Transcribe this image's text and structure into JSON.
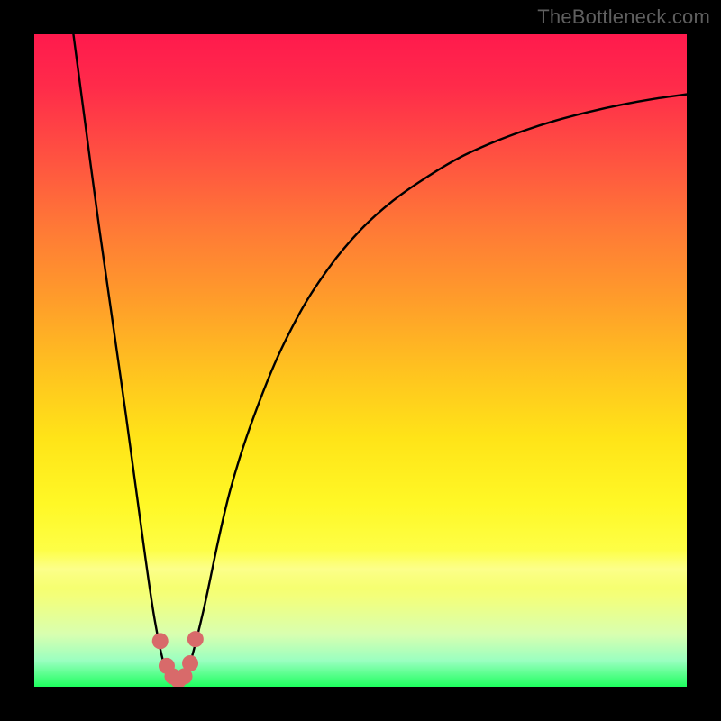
{
  "watermark": "TheBottleneck.com",
  "colors": {
    "curve_stroke": "#000000",
    "marker_fill": "#d86a6a",
    "marker_stroke": "#c45a5a"
  },
  "chart_data": {
    "type": "line",
    "title": "",
    "xlabel": "",
    "ylabel": "",
    "xlim": [
      0,
      100
    ],
    "ylim": [
      0,
      100
    ],
    "grid": false,
    "legend": false,
    "series": [
      {
        "name": "curve",
        "x": [
          6,
          10,
          14,
          17,
          18.5,
          20,
          21,
          22,
          23,
          24,
          26,
          30,
          35,
          40,
          45,
          50,
          55,
          60,
          65,
          70,
          75,
          80,
          85,
          90,
          95,
          100
        ],
        "y": [
          100,
          70,
          42,
          20,
          10,
          3,
          1.5,
          1,
          1.5,
          4,
          12,
          30,
          45,
          56,
          64,
          70,
          74.5,
          78,
          81,
          83.3,
          85.2,
          86.8,
          88.1,
          89.2,
          90.1,
          90.8
        ]
      }
    ],
    "markers": {
      "name": "bottleneck-points",
      "x": [
        19.3,
        20.3,
        21.2,
        22.1,
        23.0,
        23.9,
        24.7
      ],
      "y": [
        7.0,
        3.2,
        1.6,
        1.0,
        1.6,
        3.6,
        7.3
      ]
    }
  }
}
